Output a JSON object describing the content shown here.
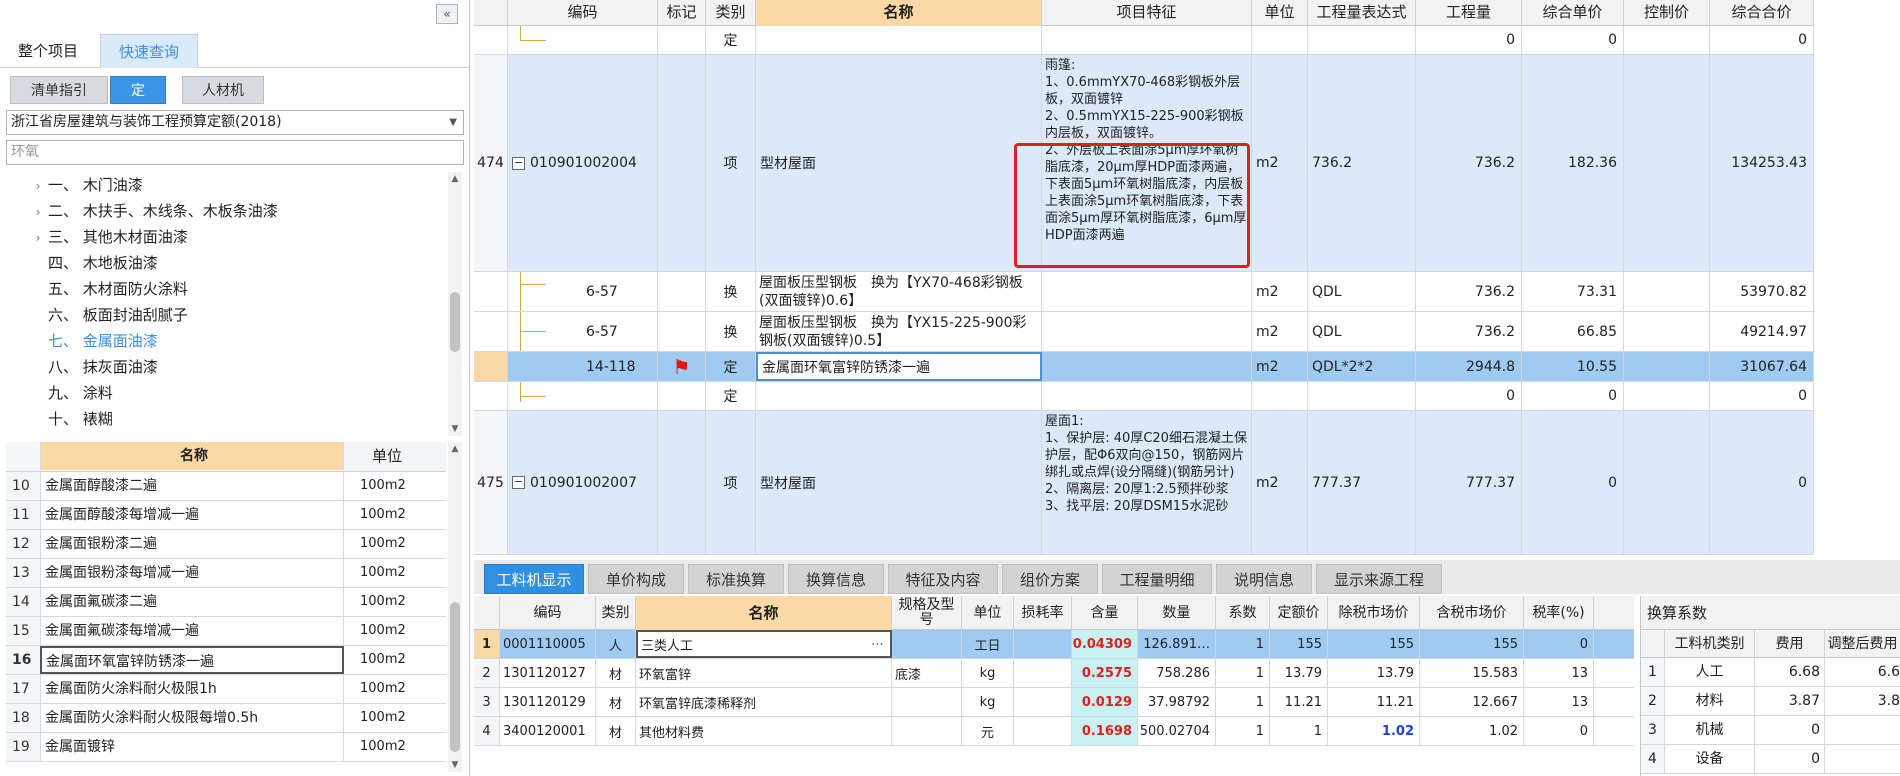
{
  "left": {
    "collapse_icon": "«",
    "top_tabs": [
      "整个项目",
      "快速查询"
    ],
    "sub_tabs": [
      "清单指引",
      "定额",
      "人材机"
    ],
    "quota_library": "浙江省房屋建筑与装饰工程预算定额(2018)",
    "search_value": "环氧",
    "tree": [
      {
        "label": "一、 木门油漆",
        "expandable": true
      },
      {
        "label": "二、 木扶手、木线条、木板条油漆",
        "expandable": true
      },
      {
        "label": "三、 其他木材面油漆",
        "expandable": true
      },
      {
        "label": "四、 木地板油漆",
        "expandable": false
      },
      {
        "label": "五、 木材面防火涂料",
        "expandable": false
      },
      {
        "label": "六、 板面封油刮腻子",
        "expandable": false
      },
      {
        "label": "七、 金属面油漆",
        "expandable": false
      },
      {
        "label": "八、 抹灰面油漆",
        "expandable": false
      },
      {
        "label": "九、 涂料",
        "expandable": false
      },
      {
        "label": "十、 裱糊",
        "expandable": false
      }
    ],
    "table_header": {
      "name": "名称",
      "unit": "单位"
    },
    "rows": [
      {
        "no": "10",
        "name": "金属面醇酸漆二遍",
        "unit": "100m2"
      },
      {
        "no": "11",
        "name": "金属面醇酸漆每增减一遍",
        "unit": "100m2"
      },
      {
        "no": "12",
        "name": "金属面银粉漆二遍",
        "unit": "100m2"
      },
      {
        "no": "13",
        "name": "金属面银粉漆每增减一遍",
        "unit": "100m2"
      },
      {
        "no": "14",
        "name": "金属面氟碳漆二遍",
        "unit": "100m2"
      },
      {
        "no": "15",
        "name": "金属面氟碳漆每增减一遍",
        "unit": "100m2"
      },
      {
        "no": "16",
        "name": "金属面环氧富锌防锈漆一遍",
        "unit": "100m2"
      },
      {
        "no": "17",
        "name": "金属面防火涂料耐火极限1h",
        "unit": "100m2"
      },
      {
        "no": "18",
        "name": "金属面防火涂料耐火极限每增0.5h",
        "unit": "100m2"
      },
      {
        "no": "19",
        "name": "金属面镀锌",
        "unit": "100m2"
      }
    ]
  },
  "grid": {
    "headers": [
      "编码",
      "标记",
      "类别",
      "名称",
      "项目特征",
      "单位",
      "工程量表达式",
      "工程量",
      "综合单价",
      "控制价",
      "综合合价"
    ],
    "rows": [
      {
        "no": "",
        "code": "",
        "type": "定",
        "name": "",
        "feature": "",
        "unit": "",
        "expr": "",
        "qty": "0",
        "price": "0",
        "ctrl": "",
        "total": "0"
      },
      {
        "no": "474",
        "code": "010901002004",
        "type": "项",
        "name": "型材屋面",
        "feature": "雨篷:\n1、0.6mmYX70-468彩钢板外层板，双面镀锌\n2、0.5mmYX15-225-900彩钢板内层板，双面镀锌。\n2、外层板上表面涂5μm厚环氧树脂底漆，20μm厚HDP面漆两遍，下表面5μm环氧树脂底漆，内层板上表面涂5μm环氧树脂底漆，下表面涂5μm厚环氧树脂底漆，6μm厚HDP面漆两遍",
        "unit": "m2",
        "expr": "736.2",
        "qty": "736.2",
        "price": "182.36",
        "ctrl": "",
        "total": "134253.43"
      },
      {
        "no": "",
        "code": "6-57",
        "type": "换",
        "name": "屋面板压型钢板　换为【YX70-468彩钢板(双面镀锌)0.6】",
        "feature": "",
        "unit": "m2",
        "expr": "QDL",
        "qty": "736.2",
        "price": "73.31",
        "ctrl": "",
        "total": "53970.82"
      },
      {
        "no": "",
        "code": "6-57",
        "type": "换",
        "name": "屋面板压型钢板　换为【YX15-225-900彩钢板(双面镀锌)0.5】",
        "feature": "",
        "unit": "m2",
        "expr": "QDL",
        "qty": "736.2",
        "price": "66.85",
        "ctrl": "",
        "total": "49214.97"
      },
      {
        "no": "",
        "code": "14-118",
        "type": "定",
        "name": "金属面环氧富锌防锈漆一遍",
        "feature": "",
        "unit": "m2",
        "expr": "QDL*2*2",
        "qty": "2944.8",
        "price": "10.55",
        "ctrl": "",
        "total": "31067.64"
      },
      {
        "no": "",
        "code": "",
        "type": "定",
        "name": "",
        "feature": "",
        "unit": "",
        "expr": "",
        "qty": "0",
        "price": "0",
        "ctrl": "",
        "total": "0"
      },
      {
        "no": "475",
        "code": "010901002007",
        "type": "项",
        "name": "型材屋面",
        "feature": "屋面1:\n1、保护层: 40厚C20细石混凝土保护层，配Φ6双向@150，钢筋网片绑扎或点焊(设分隔缝)(钢筋另计)\n2、隔离层: 20厚1:2.5预拌砂浆\n3、找平层: 20厚DSM15水泥砂",
        "unit": "m2",
        "expr": "777.37",
        "qty": "777.37",
        "price": "0",
        "ctrl": "",
        "total": "0"
      }
    ]
  },
  "bottom_tabs": [
    "工料机显示",
    "单价构成",
    "标准换算",
    "换算信息",
    "特征及内容",
    "组价方案",
    "工程量明细",
    "说明信息",
    "显示来源工程"
  ],
  "bottom_grid": {
    "headers": [
      "编码",
      "类别",
      "名称",
      "规格及型号",
      "单位",
      "损耗率",
      "含量",
      "数量",
      "系数",
      "定额价",
      "除税市场价",
      "含税市场价",
      "税率(%)"
    ],
    "rows": [
      {
        "no": "1",
        "code": "0001110005",
        "type": "人",
        "name": "三类人工",
        "spec": "",
        "unit": "工日",
        "loss": "",
        "content": "0.04309",
        "qty": "126.891…",
        "coef": "1",
        "quota": "155",
        "net": "155",
        "gross": "155",
        "tax": "0"
      },
      {
        "no": "2",
        "code": "1301120127",
        "type": "材",
        "name": "环氧富锌",
        "spec": "底漆",
        "unit": "kg",
        "loss": "",
        "content": "0.2575",
        "qty": "758.286",
        "coef": "1",
        "quota": "13.79",
        "net": "13.79",
        "gross": "15.583",
        "tax": "13"
      },
      {
        "no": "3",
        "code": "1301120129",
        "type": "材",
        "name": "环氧富锌底漆稀释剂",
        "spec": "",
        "unit": "kg",
        "loss": "",
        "content": "0.0129",
        "qty": "37.98792",
        "coef": "1",
        "quota": "11.21",
        "net": "11.21",
        "gross": "12.667",
        "tax": "13"
      },
      {
        "no": "4",
        "code": "3400120001",
        "type": "材",
        "name": "其他材料费",
        "spec": "",
        "unit": "元",
        "loss": "",
        "content": "0.1698",
        "qty": "500.02704",
        "coef": "1",
        "quota": "1",
        "net": "1.02",
        "gross": "1.02",
        "tax": "0"
      }
    ]
  },
  "coef_panel": {
    "title": "换算系数",
    "headers": [
      "工料机类别",
      "费用",
      "调整后费用"
    ],
    "rows": [
      {
        "no": "1",
        "cat": "人工",
        "fee": "6.68",
        "adj": "6.6"
      },
      {
        "no": "2",
        "cat": "材料",
        "fee": "3.87",
        "adj": "3.8"
      },
      {
        "no": "3",
        "cat": "机械",
        "fee": "0",
        "adj": ""
      },
      {
        "no": "4",
        "cat": "设备",
        "fee": "0",
        "adj": ""
      }
    ]
  },
  "colors": {
    "accent": "#2f8fe0",
    "header_name": "#fbd9a7",
    "selected_row": "#9fcbf2",
    "item_row": "#dbe9fb",
    "highlight_box": "#e02020"
  }
}
